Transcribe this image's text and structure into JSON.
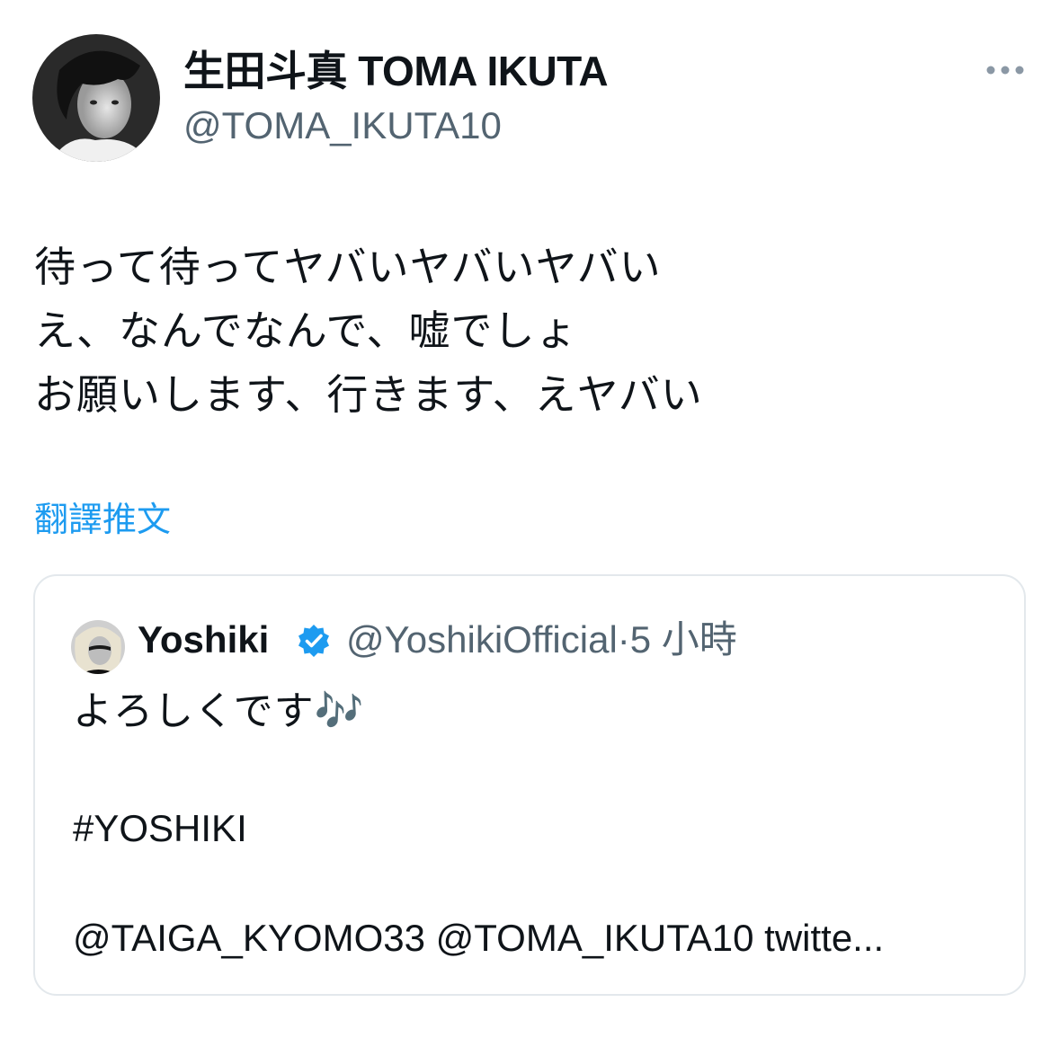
{
  "author": {
    "display_name": "生田斗真 TOMA IKUTA",
    "handle": "@TOMA_IKUTA10"
  },
  "tweet": {
    "lines": [
      "待って待ってヤバいヤバいヤバい",
      "え、なんでなんで、嘘でしょ",
      "お願いします、行きます、えヤバい"
    ],
    "translate_label": "翻譯推文"
  },
  "quoted_tweet": {
    "display_name": "Yoshiki",
    "handle": "@YoshikiOfficial",
    "separator": "·",
    "time": "5 小時",
    "line1": "よろしくです🎶",
    "hashtag": "#YOSHIKI",
    "mentions": "@TAIGA_KYOMO33  @TOMA_IKUTA10 twitte..."
  },
  "icons": {
    "more": "more-horizontal-icon",
    "verified": "verified-badge-icon"
  },
  "colors": {
    "text": "#0f1419",
    "secondary": "#536471",
    "accent": "#1d9bf0",
    "border": "#e3e8ec"
  }
}
